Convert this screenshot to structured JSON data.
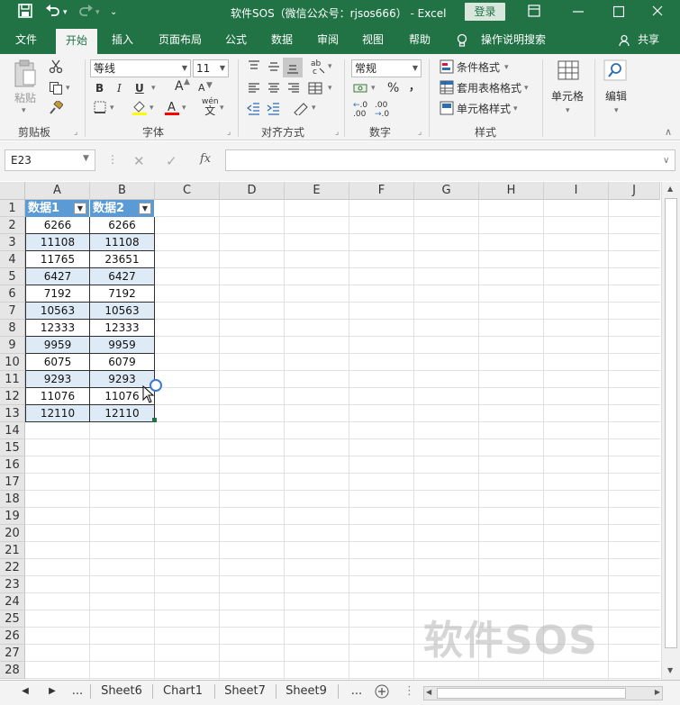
{
  "window": {
    "title": "软件SOS（微信公众号：rjsos666） - Excel",
    "login_label": "登录",
    "save_icon": "save-icon",
    "undo_icon": "undo-icon",
    "redo_icon": "redo-icon",
    "customize_icon": "quick-access-more-icon",
    "ribbon_display_icon": "ribbon-display-icon",
    "minimize_icon": "minimize-icon",
    "maximize_icon": "maximize-icon",
    "close_icon": "close-icon"
  },
  "tabs": [
    "文件",
    "开始",
    "插入",
    "页面布局",
    "公式",
    "数据",
    "审阅",
    "视图",
    "帮助"
  ],
  "active_tab": "开始",
  "tellme": "操作说明搜索",
  "share": "共享",
  "ribbon": {
    "clipboard": {
      "label": "剪贴板",
      "paste": "粘贴"
    },
    "font": {
      "label": "字体",
      "name": "等线",
      "size": "11",
      "bold": "B",
      "italic": "I",
      "underline": "U",
      "grow": "A",
      "shrink": "A",
      "wen": "wén",
      "wen_char": "文"
    },
    "alignment": {
      "label": "对齐方式"
    },
    "number": {
      "label": "数字",
      "format": "常规",
      "percent": "%",
      "comma": "，",
      "inc": ".00",
      "dec": ".0"
    },
    "styles": {
      "label": "样式",
      "conditional": "条件格式",
      "table": "套用表格格式",
      "cell": "单元格样式"
    },
    "cells": {
      "label": "单元格"
    },
    "editing": {
      "label": "编辑"
    }
  },
  "formula_bar": {
    "name_box": "E23",
    "content": "",
    "fx": "fx"
  },
  "columns": [
    "A",
    "B",
    "C",
    "D",
    "E",
    "F",
    "G",
    "H",
    "I",
    "J"
  ],
  "rows": [
    "1",
    "2",
    "3",
    "4",
    "5",
    "6",
    "7",
    "8",
    "9",
    "10",
    "11",
    "12",
    "13",
    "14",
    "15",
    "16",
    "17",
    "18",
    "19",
    "20",
    "21",
    "22",
    "23",
    "24",
    "25",
    "26",
    "27",
    "28"
  ],
  "table": {
    "headers": [
      "数据1",
      "数据2"
    ],
    "data": [
      [
        "6266",
        "6266"
      ],
      [
        "11108",
        "11108"
      ],
      [
        "11765",
        "23651"
      ],
      [
        "6427",
        "6427"
      ],
      [
        "7192",
        "7192"
      ],
      [
        "10563",
        "10563"
      ],
      [
        "12333",
        "12333"
      ],
      [
        "9959",
        "9959"
      ],
      [
        "6075",
        "6079"
      ],
      [
        "9293",
        "9293"
      ],
      [
        "11076",
        "11076"
      ],
      [
        "12110",
        "12110"
      ]
    ]
  },
  "sheets": [
    "Sheet6",
    "Chart1",
    "Sheet7",
    "Sheet9"
  ],
  "ellipsis": "...",
  "watermark": "软件SOS",
  "colors": {
    "excel_green": "#217346",
    "table_header": "#5b9bd5",
    "table_stripe": "#deebf7"
  }
}
